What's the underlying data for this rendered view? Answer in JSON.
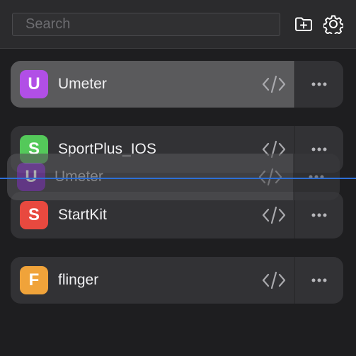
{
  "search": {
    "placeholder": "Search",
    "value": ""
  },
  "toolbar": {
    "new_folder_icon": "folder-plus-icon",
    "settings_icon": "gear-icon"
  },
  "projects": [
    {
      "letter": "U",
      "name": "Umeter",
      "color": "#b14fe6",
      "state": "hovered"
    },
    {
      "letter": "S",
      "name": "SportPlus_IOS",
      "color": "#54c95a",
      "state": "normal"
    },
    {
      "letter": "S",
      "name": "StartKit",
      "color": "#e8493f",
      "state": "normal"
    },
    {
      "letter": "F",
      "name": "flinger",
      "color": "#f0a33a",
      "state": "normal"
    }
  ],
  "drag_ghost": {
    "letter": "U",
    "name": "Umeter",
    "color": "#8a47c2"
  },
  "colors": {
    "drop_indicator": "#2d6fd6",
    "background": "#1e1e20",
    "card": "#323235"
  }
}
